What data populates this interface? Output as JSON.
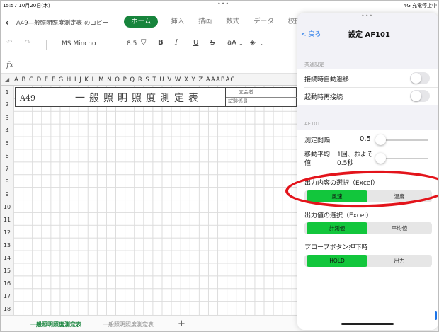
{
  "status": {
    "time_date": "15:57  10月20日(木)",
    "right": "4G 充電停止中"
  },
  "header": {
    "doc_title": "A49—般照明照度測定表 のコピー",
    "tabs": [
      {
        "label": "ホーム",
        "active": true
      },
      {
        "label": "挿入"
      },
      {
        "label": "描画"
      },
      {
        "label": "数式"
      },
      {
        "label": "データ"
      },
      {
        "label": "校閲"
      }
    ]
  },
  "toolbar": {
    "font_name": "MS Mincho",
    "font_size": "8.5",
    "bold": "B",
    "italic": "I",
    "underline": "U",
    "strike": "S",
    "font_grow": "aA",
    "fill": "ᕐ"
  },
  "formula_bar": {
    "fx": "fx"
  },
  "grid": {
    "columns": "A B C D E F G H I J K L M N O P Q R S T U V W X Y Z AAABAC",
    "rows": [
      "1",
      "2",
      "3",
      "4",
      "5",
      "6",
      "7",
      "8",
      "9",
      "10",
      "11",
      "12",
      "13",
      "14",
      "15",
      "16",
      "17",
      "18"
    ]
  },
  "sheet": {
    "code": "A49",
    "title": "一般照明照度測定表",
    "box_top": "立会者",
    "box_bottom": "試験係員"
  },
  "sheet_tabs": {
    "active": "一般照明照度測定表",
    "other": "一般照明照度測定表...",
    "add": "+"
  },
  "panel": {
    "back_label": "< 戻る",
    "title": "設定 AF101",
    "common_section": "共通設定",
    "auto_transition": "接続時自動遷移",
    "auto_reconnect": "起動時再接続",
    "af_section": "AF101",
    "interval_label": "測定間隔",
    "interval_value": "0.5",
    "moving_avg_label": "移動平均値",
    "moving_avg_value": "1回、およそ0.5秒",
    "output_content_label": "出力内容の選択（Excel）",
    "output_content_options": [
      "風速",
      "温度"
    ],
    "output_value_label": "出力値の選択（Excel）",
    "output_value_options": [
      "計測値",
      "平均値"
    ],
    "probe_button_label": "プローブボタン押下時",
    "probe_button_options": [
      "HOLD",
      "出力"
    ]
  },
  "colors": {
    "accent_green": "#17843c",
    "segment_green": "#12c63c",
    "annotation_red": "#e3141b",
    "link_blue": "#1a73e8"
  }
}
